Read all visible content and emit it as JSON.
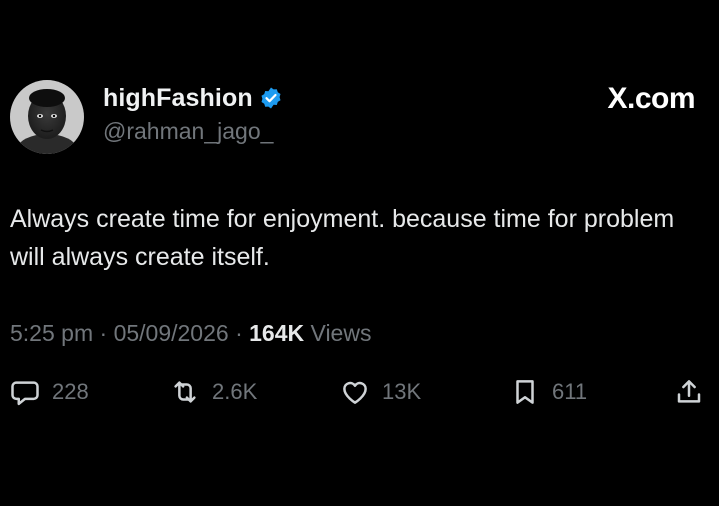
{
  "author": {
    "display_name": "highFashion",
    "handle": "@rahman_jago_",
    "verified": true,
    "verified_color": "#1d9bf0"
  },
  "site_label": "X.com",
  "tweet": {
    "text": "Always create time for enjoyment. because time for problem will always create itself."
  },
  "meta": {
    "time": "5:25 pm",
    "sep1": " · ",
    "date": "05/09/2026",
    "sep2": " · ",
    "views_count": "164K",
    "views_label": " Views"
  },
  "actions": {
    "replies": "228",
    "reposts": "2.6K",
    "likes": "13K",
    "bookmarks": "611"
  },
  "icons": {
    "reply": "speech-bubble-icon",
    "repost": "repost-arrows-icon",
    "like": "heart-icon",
    "bookmark": "bookmark-icon",
    "share": "share-upload-icon"
  }
}
